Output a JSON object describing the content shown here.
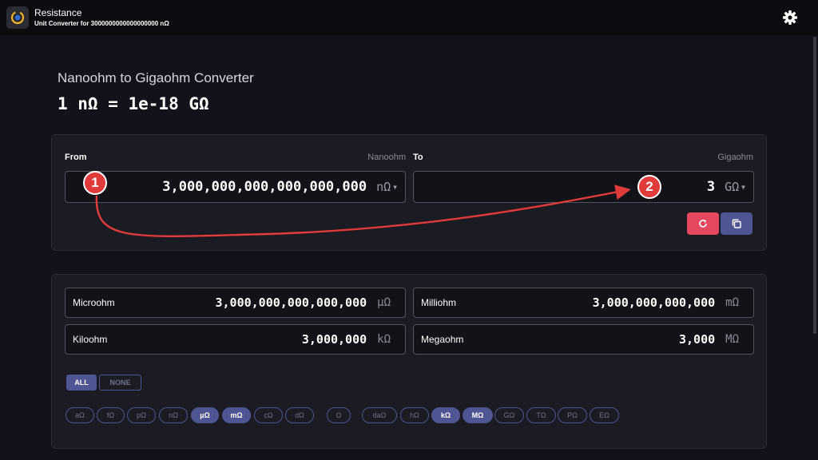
{
  "app": {
    "title": "Resistance",
    "subtitle": "Unit Converter for 3000000000000000000 nΩ",
    "icon": "converter-app-icon",
    "settings_icon": "gear-icon"
  },
  "header": {
    "title": "Nanoohm to Gigaohm Converter",
    "formula": "1 nΩ = 1e-18 GΩ"
  },
  "converter": {
    "from_label": "From",
    "from_unit_name": "Nanoohm",
    "from_value": "3,000,000,000,000,000,000",
    "from_unit": "nΩ",
    "to_label": "To",
    "to_unit_name": "Gigaohm",
    "to_value": "3",
    "to_unit": "GΩ",
    "reset_icon": "refresh-icon",
    "copy_icon": "copy-icon"
  },
  "results": [
    {
      "name": "Microohm",
      "value": "3,000,000,000,000,000",
      "unit": "µΩ"
    },
    {
      "name": "Milliohm",
      "value": "3,000,000,000,000",
      "unit": "mΩ"
    },
    {
      "name": "Kiloohm",
      "value": "3,000,000",
      "unit": "kΩ"
    },
    {
      "name": "Megaohm",
      "value": "3,000",
      "unit": "MΩ"
    }
  ],
  "filters": {
    "all_label": "ALL",
    "none_label": "NONE"
  },
  "chips": [
    {
      "label": "aΩ",
      "active": false
    },
    {
      "label": "fΩ",
      "active": false
    },
    {
      "label": "pΩ",
      "active": false
    },
    {
      "label": "nΩ",
      "active": false
    },
    {
      "label": "µΩ",
      "active": true
    },
    {
      "label": "mΩ",
      "active": true
    },
    {
      "label": "cΩ",
      "active": false
    },
    {
      "label": "dΩ",
      "active": false
    },
    {
      "label": "Ω",
      "active": false
    },
    {
      "label": "daΩ",
      "active": false
    },
    {
      "label": "hΩ",
      "active": false
    },
    {
      "label": "kΩ",
      "active": true
    },
    {
      "label": "MΩ",
      "active": true
    },
    {
      "label": "GΩ",
      "active": false
    },
    {
      "label": "TΩ",
      "active": false
    },
    {
      "label": "PΩ",
      "active": false
    },
    {
      "label": "EΩ",
      "active": false
    }
  ],
  "annotations": {
    "badge1": "1",
    "badge2": "2",
    "color": "#e03a3a"
  },
  "colors": {
    "accent": "#4f5593",
    "danger": "#e6485f",
    "background": "#12131a"
  }
}
